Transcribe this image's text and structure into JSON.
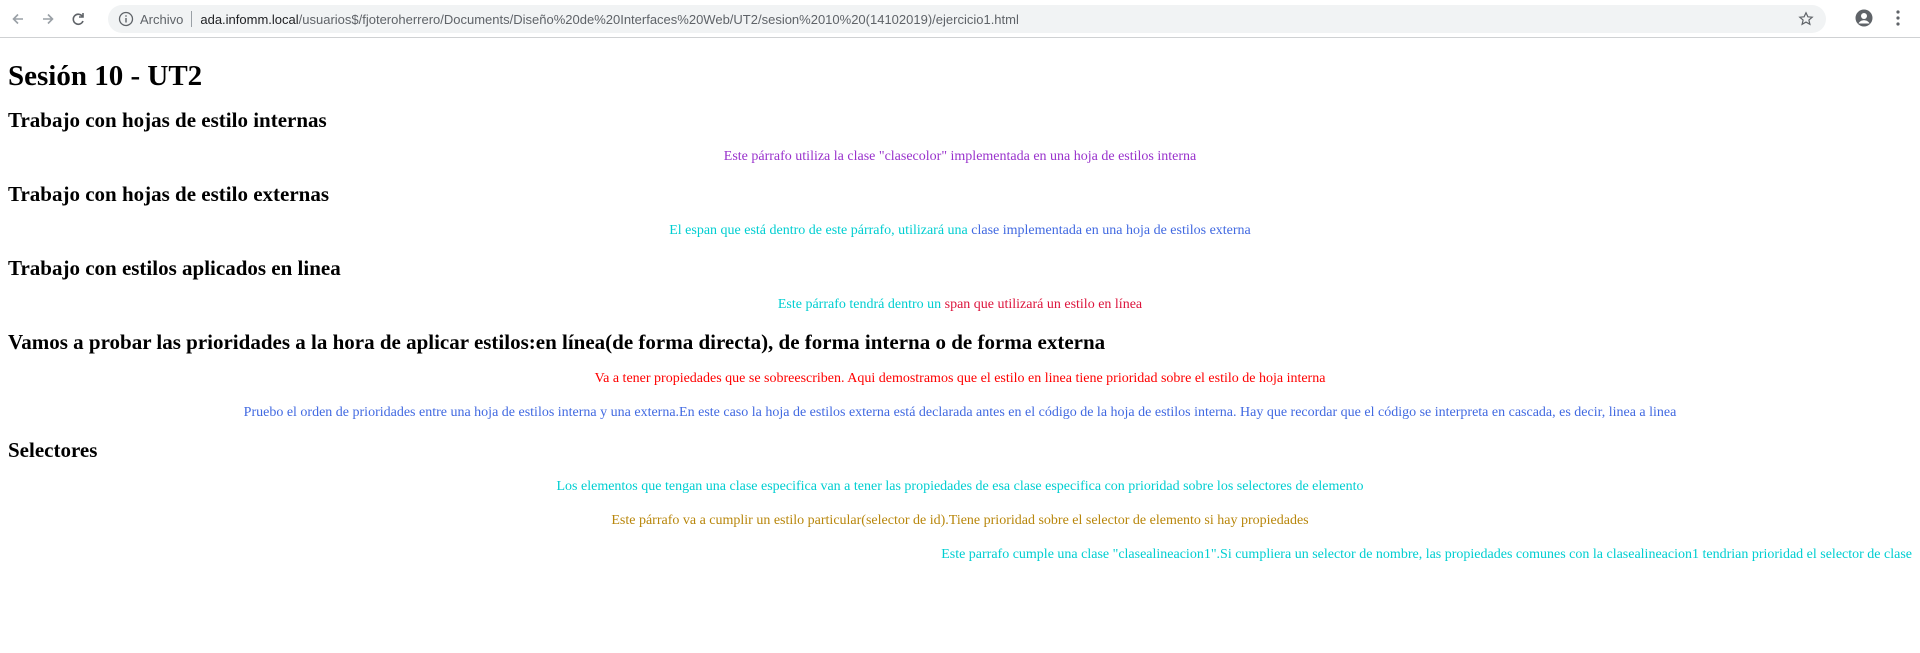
{
  "browser": {
    "scheme_label": "Archivo",
    "url_host": "ada.infomm.local",
    "url_path": "/usuarios$/fjoteroherrero/Documents/Dise%C3%B1o%20de%20Interfaces%20Web/UT2/sesion%2010%20(14102019)/ejercicio1.html",
    "url_path_display": "/usuarios$/fjoteroherrero/Documents/Diseño%20de%20Interfaces%20Web/UT2/sesion%2010%20(14102019)/ejercicio1.html"
  },
  "page": {
    "title": "Sesión 10 - UT2",
    "sections": [
      {
        "heading": "Trabajo con hojas de estilo internas"
      },
      {
        "heading": "Trabajo con hojas de estilo externas"
      },
      {
        "heading": "Trabajo con estilos aplicados en linea"
      },
      {
        "heading": "Vamos a probar las prioridades a la hora de aplicar estilos:en línea(de forma directa), de forma interna o de forma externa"
      },
      {
        "heading": "Selectores"
      }
    ],
    "p1": "Este párrafo utiliza la clase \"clasecolor\" implementada en una hoja de estilos interna",
    "p2_a": "El espan que está dentro de este párrafo, utilizará una ",
    "p2_b": "clase implementada en una hoja de estilos externa",
    "p3_a": "Este párrafo tendrá dentro un ",
    "p3_b": "span que utilizará un estilo en línea",
    "p4": "Va a tener propiedades que se sobreescriben. Aqui demostramos que el estilo en linea tiene prioridad sobre el estilo de hoja interna",
    "p5": "Pruebo el orden de prioridades entre una hoja de estilos interna y una externa.En este caso la hoja de estilos externa está declarada antes en el código de la hoja de estilos interna. Hay que recordar que el código se interpreta en cascada, es decir, linea a linea",
    "p6": "Los elementos que tengan una clase especifica van a tener las propiedades de esa clase especifica con prioridad sobre los selectores de elemento",
    "p7": "Este párrafo va a cumplir un estilo particular(selector de id).Tiene prioridad sobre el selector de elemento si hay propiedades",
    "p8": "Este parrafo cumple una clase \"clasealineacion1\".Si cumpliera un selector de nombre, las propiedades comunes con la clasealineacion1 tendrian prioridad el selector de clase"
  },
  "colors": {
    "purple": "#9932CC",
    "cyan": "#00CED1",
    "royal_blue": "#4169E1",
    "crimson": "#DC143C",
    "red": "#FF0000",
    "dark_goldenrod": "#B8860B"
  },
  "icons": [
    "back-arrow-icon",
    "forward-arrow-icon",
    "reload-icon",
    "info-icon",
    "star-icon",
    "account-icon",
    "menu-icon"
  ]
}
